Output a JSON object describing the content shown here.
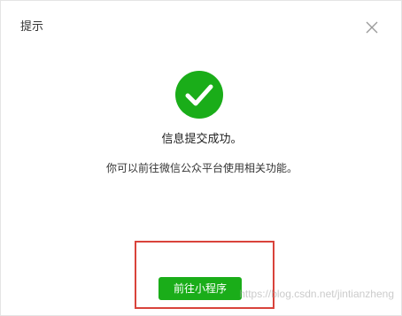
{
  "dialog": {
    "title": "提示",
    "close_icon": "close-icon"
  },
  "result": {
    "icon": "success-check-icon",
    "icon_color": "#1aad19",
    "primary_message": "信息提交成功。",
    "secondary_message": "你可以前往微信公众平台使用相关功能。"
  },
  "actions": {
    "goto_miniprogram_label": "前往小程序",
    "button_color": "#1aad19"
  },
  "annotation": {
    "highlight_color": "#d9433b"
  },
  "watermark": {
    "text": "https://blog.csdn.net/jintianzheng"
  }
}
